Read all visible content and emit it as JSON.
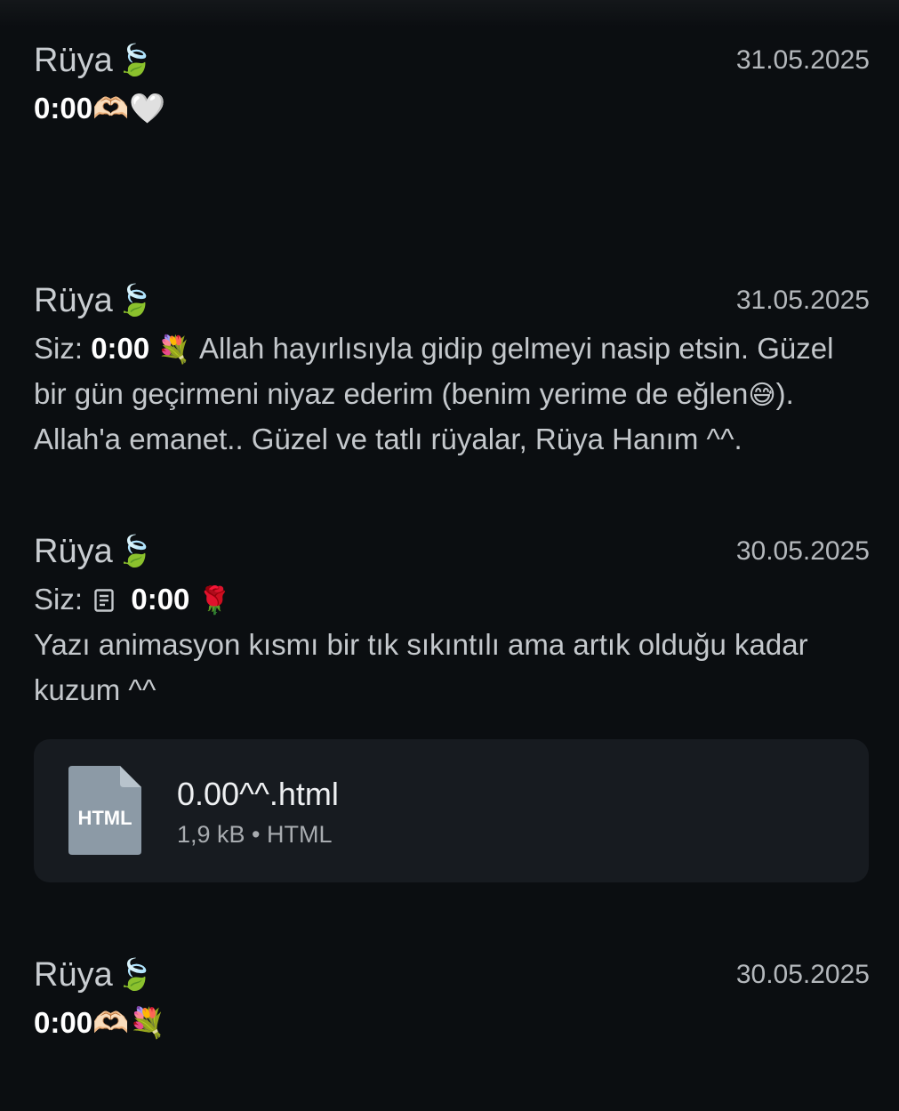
{
  "conversations": [
    {
      "sender": "Rüya",
      "sender_emoji": "🍃",
      "date": "31.05.2025",
      "preview": "0:00🫶🏻🤍"
    },
    {
      "sender": "Rüya",
      "sender_emoji": "🍃",
      "date": "31.05.2025",
      "prefix": "Siz:",
      "time": "0:00",
      "emoji": "💐",
      "text_1": "Allah hayırlısıyla gidip gelmeyi nasip etsin. Güzel bir gün geçirmeni niyaz ederim (benim yerime de eğlen",
      "emoji_2": "😅",
      "text_2": "). Allah'a emanet..  Güzel ve tatlı rüyalar, Rüya Hanım ^^."
    },
    {
      "sender": "Rüya",
      "sender_emoji": "🍃",
      "date": "30.05.2025",
      "prefix": "Siz:",
      "doc_icon": "document-icon",
      "time": "0:00",
      "emoji": "🌹",
      "text": "Yazı animasyon kısmı bir tık sıkıntılı ama artık olduğu kadar kuzum ^^",
      "attachment": {
        "type_label": "HTML",
        "name": "0.00^^.html",
        "meta": "1,9 kB • HTML"
      }
    },
    {
      "sender": "Rüya",
      "sender_emoji": "🍃",
      "date": "30.05.2025",
      "preview": "0:00🫶🏻💐"
    }
  ],
  "colors": {
    "background": "#0b0e11",
    "card": "#171b20",
    "file_icon": "#8c9aa6",
    "text": "#c4c8cc",
    "strong": "#ffffff"
  }
}
